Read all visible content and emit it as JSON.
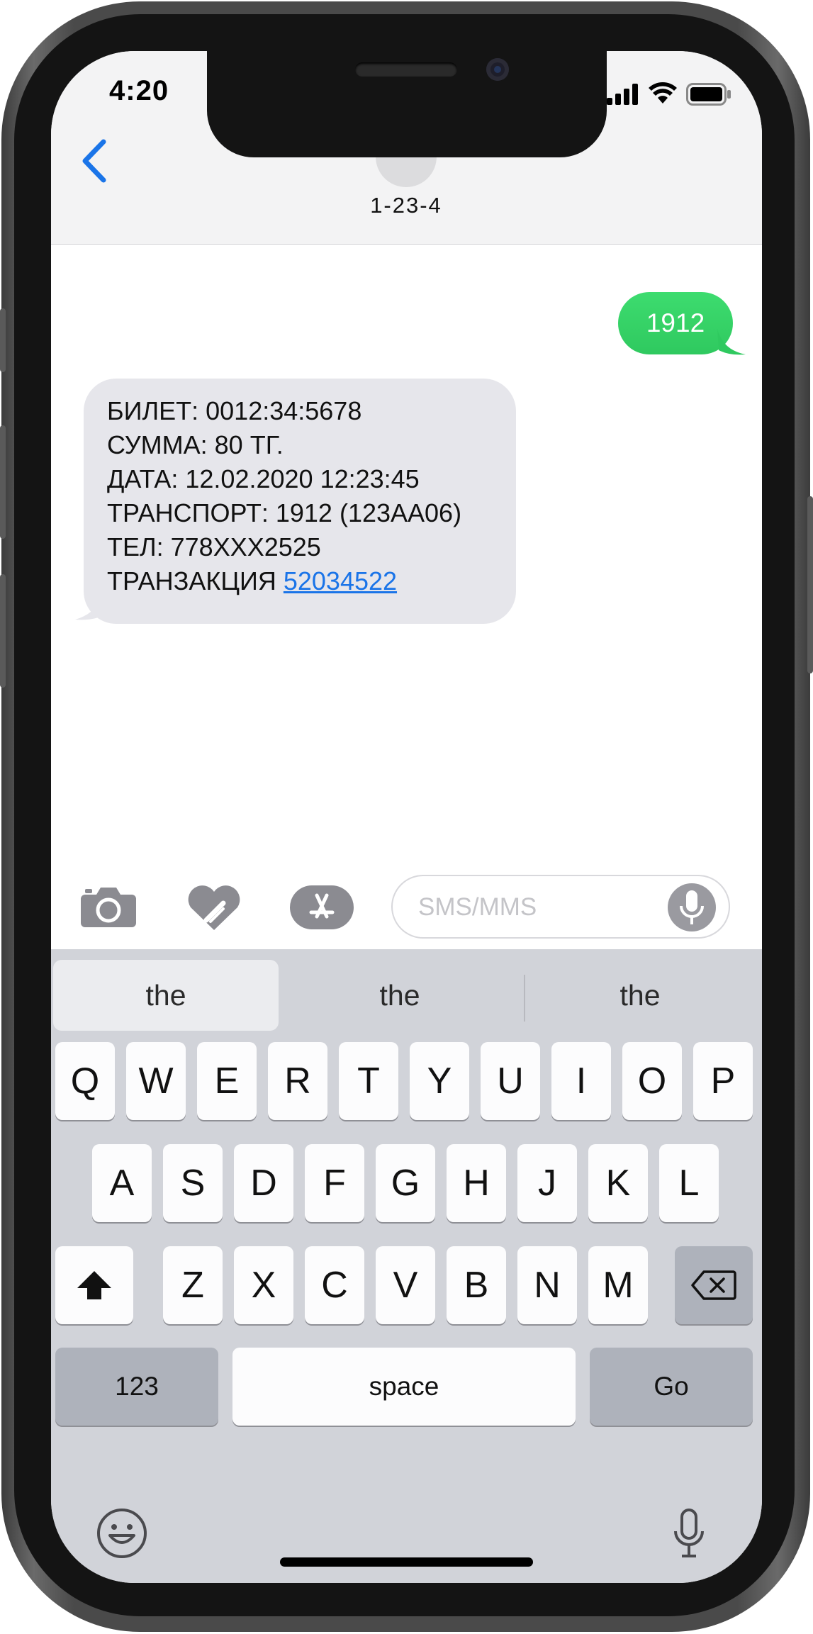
{
  "status_bar": {
    "time": "4:20"
  },
  "header": {
    "back_icon": "chevron-left-icon",
    "contact_name": "1-23-4"
  },
  "messages": {
    "outgoing": {
      "text": "1912"
    },
    "incoming": {
      "lines": [
        "БИЛЕТ: 0012:34:5678",
        "СУММА: 80 ТГ.",
        "ДАТА: 12.02.2020 12:23:45",
        "ТРАНСПОРТ: 1912 (123АА06)",
        "ТЕЛ: 778XXX2525"
      ],
      "transaction_label": "ТРАНЗАКЦИЯ",
      "transaction_link": "52034522"
    }
  },
  "input_bar": {
    "placeholder": "SMS/MMS",
    "icons": [
      "camera-icon",
      "digital-touch-icon",
      "app-store-icon",
      "microphone-icon"
    ]
  },
  "keyboard": {
    "suggestions": [
      "the",
      "the",
      "the"
    ],
    "row1": [
      "Q",
      "W",
      "E",
      "R",
      "T",
      "Y",
      "U",
      "I",
      "O",
      "P"
    ],
    "row2": [
      "A",
      "S",
      "D",
      "F",
      "G",
      "H",
      "J",
      "K",
      "L"
    ],
    "row3": [
      "Z",
      "X",
      "C",
      "V",
      "B",
      "N",
      "M"
    ],
    "numbers_label": "123",
    "space_label": "space",
    "go_label": "Go",
    "bottom_icons": [
      "emoji-icon",
      "dictation-icon"
    ]
  },
  "colors": {
    "accent_blue": "#1a74e8",
    "outgoing_bubble": "#34d165",
    "incoming_bubble": "#e6e6eb",
    "keyboard_bg": "#d1d3d9"
  }
}
